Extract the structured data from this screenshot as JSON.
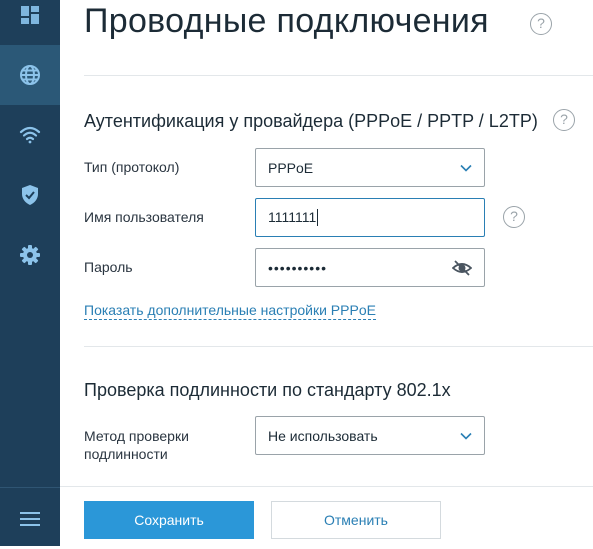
{
  "sidebar": {
    "items": [
      {
        "icon": "dashboard-icon"
      },
      {
        "icon": "globe-icon",
        "active": true
      },
      {
        "icon": "wifi-icon"
      },
      {
        "icon": "shield-icon"
      },
      {
        "icon": "gear-icon"
      }
    ],
    "menu_icon": "hamburger-menu-icon"
  },
  "page": {
    "title": "Проводные подключения",
    "help_symbol": "?"
  },
  "auth_section": {
    "title": "Аутентификация у провайдера (PPPoE / PPTP / L2TP)",
    "help_symbol": "?",
    "protocol": {
      "label": "Тип (протокол)",
      "value": "PPPoE"
    },
    "username": {
      "label": "Имя пользователя",
      "value": "1111111",
      "help_symbol": "?"
    },
    "password": {
      "label": "Пароль",
      "value": "••••••••••"
    },
    "more_link": "Показать дополнительные настройки PPPoE"
  },
  "dot1x_section": {
    "title": "Проверка подлинности по стандарту 802.1x",
    "method": {
      "label_line1": "Метод проверки",
      "label_line2": "подлинности",
      "value": "Не использовать"
    }
  },
  "footer": {
    "save_label": "Сохранить",
    "cancel_label": "Отменить"
  },
  "colors": {
    "sidebar_bg": "#1e3f5a",
    "sidebar_active": "#2b5877",
    "accent": "#2b97d8",
    "link": "#2a7fb4"
  }
}
